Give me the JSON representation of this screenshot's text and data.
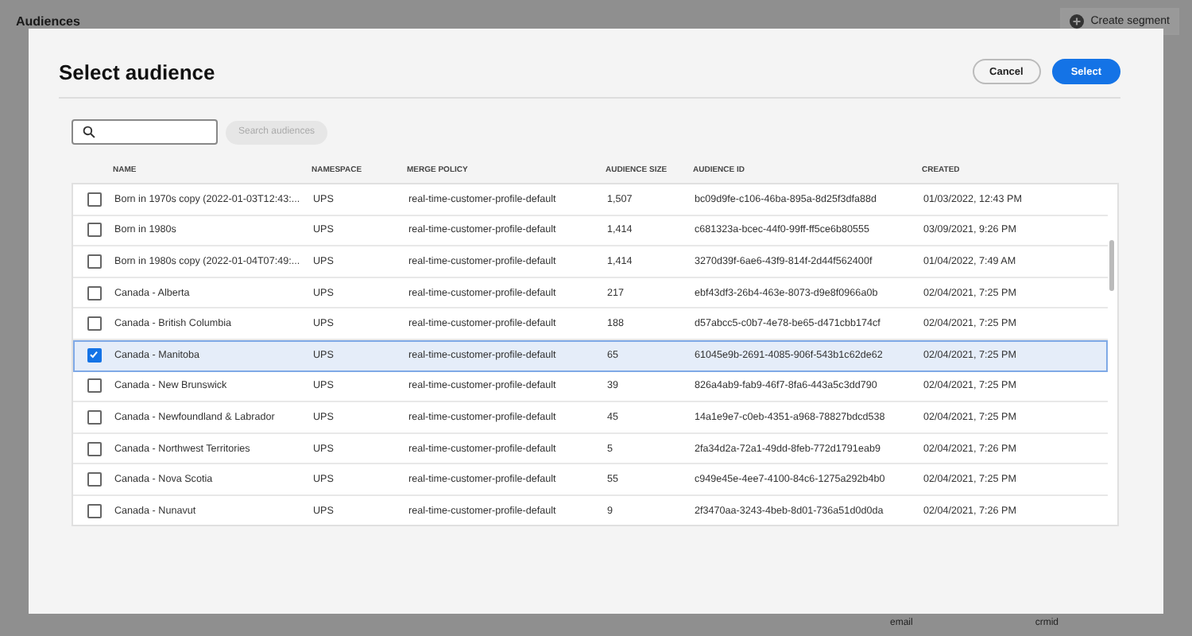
{
  "page": {
    "title": "Audiences",
    "create_button": "Create segment",
    "chart_labels": [
      "email",
      "crmid"
    ]
  },
  "dialog": {
    "title": "Select audience",
    "cancel": "Cancel",
    "select": "Select",
    "search_button": {
      "label": "Search audiences",
      "disabled": true
    },
    "columns": [
      "NAME",
      "NAMESPACE",
      "MERGE POLICY",
      "AUDIENCE SIZE",
      "AUDIENCE ID",
      "CREATED"
    ],
    "rows": [
      {
        "selected": false,
        "cells": [
          "Born in 1970s copy (2022-01-03T12:43:...",
          "UPS",
          "real-time-customer-profile-default",
          "1,507",
          "bc09d9fe-c106-46ba-895a-8d25f3dfa88d",
          "01/03/2022, 12:43 PM"
        ]
      },
      {
        "selected": false,
        "cells": [
          "Born in 1980s",
          "UPS",
          "real-time-customer-profile-default",
          "1,414",
          "c681323a-bcec-44f0-99ff-ff5ce6b80555",
          "03/09/2021, 9:26 PM"
        ]
      },
      {
        "selected": false,
        "cells": [
          "Born in 1980s copy (2022-01-04T07:49:...",
          "UPS",
          "real-time-customer-profile-default",
          "1,414",
          "3270d39f-6ae6-43f9-814f-2d44f562400f",
          "01/04/2022, 7:49 AM"
        ]
      },
      {
        "selected": false,
        "cells": [
          "Canada - Alberta",
          "UPS",
          "real-time-customer-profile-default",
          "217",
          "ebf43df3-26b4-463e-8073-d9e8f0966a0b",
          "02/04/2021, 7:25 PM"
        ]
      },
      {
        "selected": false,
        "cells": [
          "Canada - British Columbia",
          "UPS",
          "real-time-customer-profile-default",
          "188",
          "d57abcc5-c0b7-4e78-be65-d471cbb174cf",
          "02/04/2021, 7:25 PM"
        ]
      },
      {
        "selected": true,
        "cells": [
          "Canada - Manitoba",
          "UPS",
          "real-time-customer-profile-default",
          "65",
          "61045e9b-2691-4085-906f-543b1c62de62",
          "02/04/2021, 7:25 PM"
        ]
      },
      {
        "selected": false,
        "cells": [
          "Canada - New Brunswick",
          "UPS",
          "real-time-customer-profile-default",
          "39",
          "826a4ab9-fab9-46f7-8fa6-443a5c3dd790",
          "02/04/2021, 7:25 PM"
        ]
      },
      {
        "selected": false,
        "cells": [
          "Canada - Newfoundland & Labrador",
          "UPS",
          "real-time-customer-profile-default",
          "45",
          "14a1e9e7-c0eb-4351-a968-78827bdcd538",
          "02/04/2021, 7:25 PM"
        ]
      },
      {
        "selected": false,
        "cells": [
          "Canada - Northwest Territories",
          "UPS",
          "real-time-customer-profile-default",
          "5",
          "2fa34d2a-72a1-49dd-8feb-772d1791eab9",
          "02/04/2021, 7:26 PM"
        ]
      },
      {
        "selected": false,
        "cells": [
          "Canada - Nova Scotia",
          "UPS",
          "real-time-customer-profile-default",
          "55",
          "c949e45e-4ee7-4100-84c6-1275a292b4b0",
          "02/04/2021, 7:25 PM"
        ]
      },
      {
        "selected": false,
        "cells": [
          "Canada - Nunavut",
          "UPS",
          "real-time-customer-profile-default",
          "9",
          "2f3470aa-3243-4beb-8d01-736a51d0d0da",
          "02/04/2021, 7:26 PM"
        ]
      }
    ]
  }
}
